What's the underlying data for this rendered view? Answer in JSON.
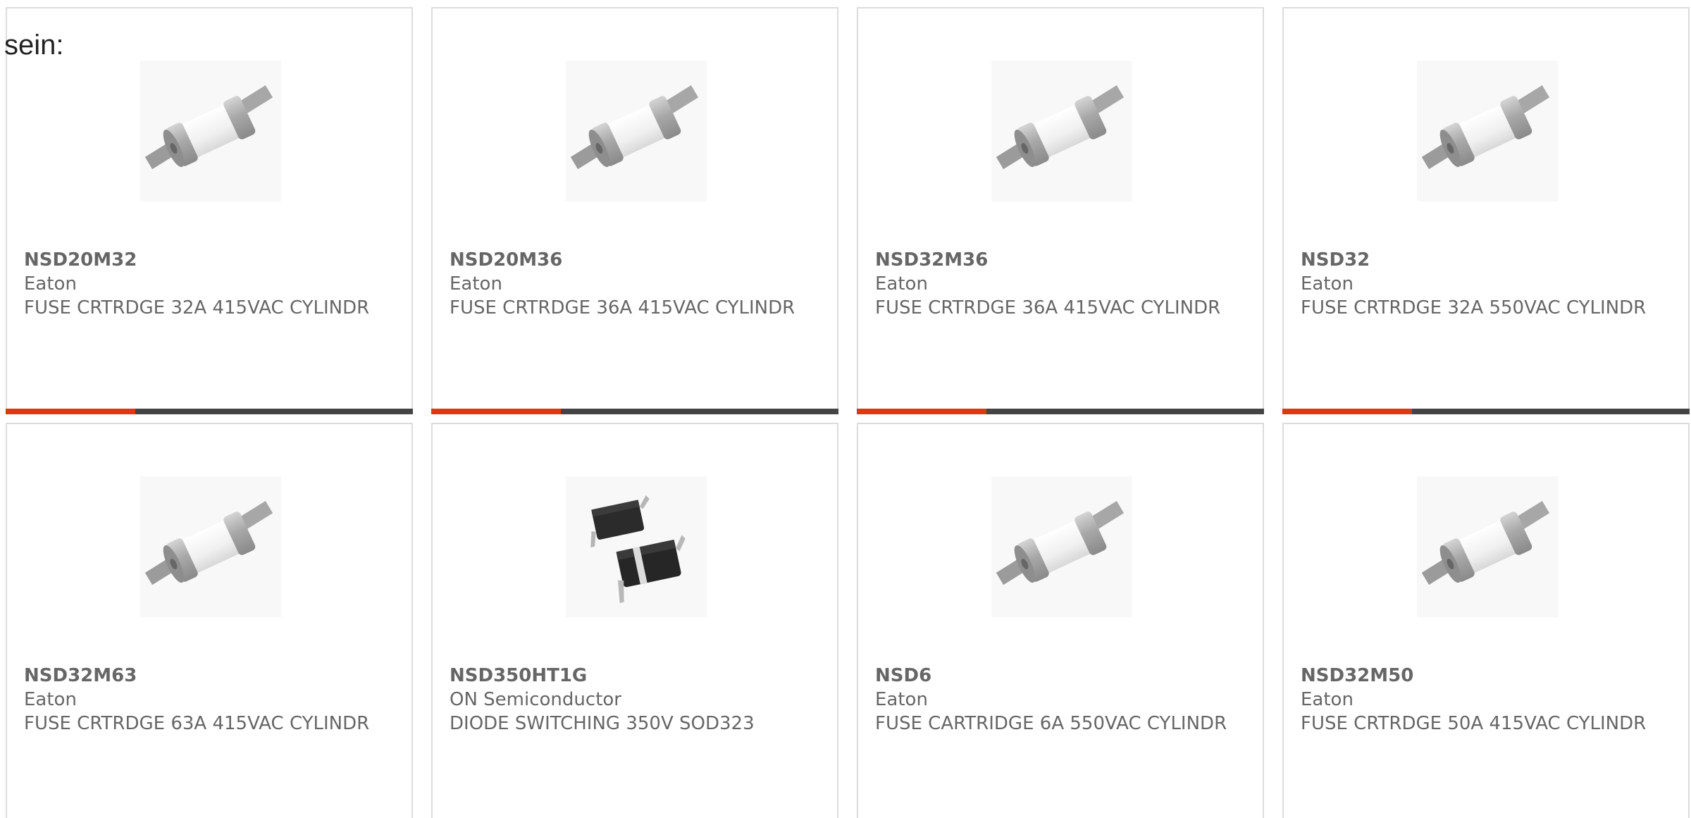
{
  "intro_text": "sein:",
  "products": [
    {
      "part_number": "NSD20M32",
      "manufacturer": "Eaton",
      "description": "FUSE CRTRDGE 32A 415VAC CYLINDR",
      "image": "cartridge-fuse-icon"
    },
    {
      "part_number": "NSD20M36",
      "manufacturer": "Eaton",
      "description": "FUSE CRTRDGE 36A 415VAC CYLINDR",
      "image": "cartridge-fuse-icon"
    },
    {
      "part_number": "NSD32M36",
      "manufacturer": "Eaton",
      "description": "FUSE CRTRDGE 36A 415VAC CYLINDR",
      "image": "cartridge-fuse-icon"
    },
    {
      "part_number": "NSD32",
      "manufacturer": "Eaton",
      "description": "FUSE CRTRDGE 32A 550VAC CYLINDR",
      "image": "cartridge-fuse-icon"
    },
    {
      "part_number": "NSD32M63",
      "manufacturer": "Eaton",
      "description": "FUSE CRTRDGE 63A 415VAC CYLINDR",
      "image": "cartridge-fuse-icon"
    },
    {
      "part_number": "NSD350HT1G",
      "manufacturer": "ON Semiconductor",
      "description": "DIODE SWITCHING 350V SOD323",
      "image": "sod323-diode-icon"
    },
    {
      "part_number": "NSD6",
      "manufacturer": "Eaton",
      "description": "FUSE CARTRIDGE 6A 550VAC CYLINDR",
      "image": "cartridge-fuse-icon"
    },
    {
      "part_number": "NSD32M50",
      "manufacturer": "Eaton",
      "description": "FUSE CRTRDGE 50A 415VAC CYLINDR",
      "image": "cartridge-fuse-icon"
    }
  ],
  "colors": {
    "accent": "#e0380a",
    "bar_dark": "#444444",
    "card_border": "#dcdcdc",
    "text_gray": "#666666"
  }
}
